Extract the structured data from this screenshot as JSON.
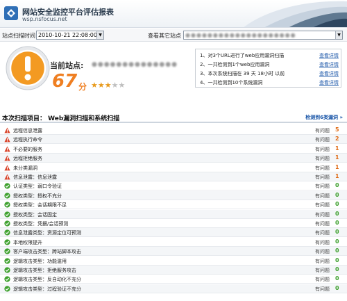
{
  "header": {
    "title": "网站安全监控平台评估报表",
    "subtitle": "wsp.nsfocus.net"
  },
  "filter": {
    "time_label": "站点扫描时间",
    "time_value": "2010-10-21 22:08:00",
    "site_label": "查看其它站点",
    "site_value": "●●●●●●●●●●●●●●●●●●●●"
  },
  "summary": {
    "site_label": "当前站点:",
    "site_value": "●●●●●●●●●●●●●●",
    "score": "67",
    "score_unit": "分",
    "rating": 3,
    "rating_max": 5,
    "stats": [
      {
        "text": "1、对3个URL进行了web应用漏洞扫描",
        "link": "查看详情"
      },
      {
        "text": "2、一共检测到1个web应用漏洞",
        "link": "查看详情"
      },
      {
        "text": "3、本次系统扫描在 39 天 18小时 以前",
        "link": "查看详情"
      },
      {
        "text": "4、一共检测到10个系统漏洞",
        "link": "查看详情"
      }
    ]
  },
  "section": {
    "title": "本次扫描项目： Web漏洞扫描和系统扫描",
    "link": "检测到6类漏洞 »"
  },
  "colors": {
    "warn": "#d9442b",
    "ok": "#3fa12f",
    "count_warn": "#e06a14",
    "count_ok": "#3fa12f"
  },
  "items": [
    {
      "name": "远程信息泄露",
      "status": "有问题",
      "count": "5",
      "type": "warn"
    },
    {
      "name": "远程执行命令",
      "status": "有问题",
      "count": "2",
      "type": "warn"
    },
    {
      "name": "不必要的服务",
      "status": "有问题",
      "count": "1",
      "type": "warn"
    },
    {
      "name": "远程拒绝服务",
      "status": "有问题",
      "count": "1",
      "type": "warn"
    },
    {
      "name": "未分类漏洞",
      "status": "有问题",
      "count": "1",
      "type": "warn"
    },
    {
      "name": "信息泄露：信息泄露",
      "status": "有问题",
      "count": "1",
      "type": "warn"
    },
    {
      "name": "认证类型：弱口令验证",
      "status": "有问题",
      "count": "0",
      "type": "ok"
    },
    {
      "name": "授权类型：授权不充分",
      "status": "有问题",
      "count": "0",
      "type": "ok"
    },
    {
      "name": "授权类型：会话期限不足",
      "status": "有问题",
      "count": "0",
      "type": "ok"
    },
    {
      "name": "授权类型：会话固定",
      "status": "有问题",
      "count": "0",
      "type": "ok"
    },
    {
      "name": "授权类型：凭据/会话预测",
      "status": "有问题",
      "count": "0",
      "type": "ok"
    },
    {
      "name": "信息泄露类型：资源定位可预测",
      "status": "有问题",
      "count": "0",
      "type": "ok"
    },
    {
      "name": "本地权限提升",
      "status": "有问题",
      "count": "0",
      "type": "ok"
    },
    {
      "name": "客户端攻击类型：跨站脚本攻击",
      "status": "有问题",
      "count": "0",
      "type": "ok"
    },
    {
      "name": "逻辑攻击类型：功能滥用",
      "status": "有问题",
      "count": "0",
      "type": "ok"
    },
    {
      "name": "逻辑攻击类型：拒绝服务攻击",
      "status": "有问题",
      "count": "0",
      "type": "ok"
    },
    {
      "name": "逻辑攻击类型：反自动化不充分",
      "status": "有问题",
      "count": "0",
      "type": "ok"
    },
    {
      "name": "逻辑攻击类型：过程验证不充分",
      "status": "有问题",
      "count": "0",
      "type": "ok"
    }
  ]
}
